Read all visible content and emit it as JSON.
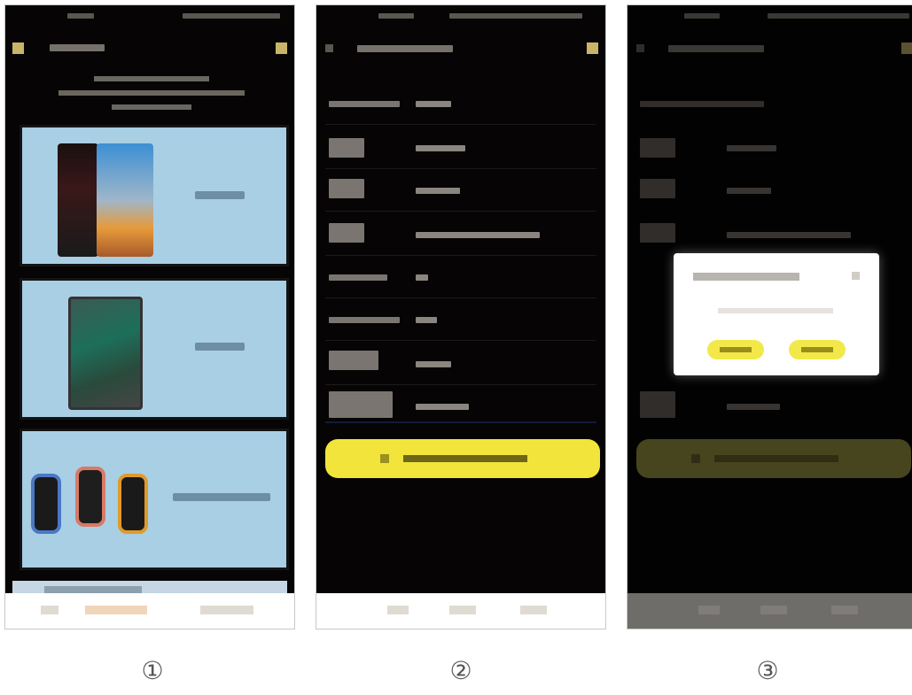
{
  "steps": [
    "①",
    "②",
    "③"
  ],
  "colors": {
    "screen_bg": "#060404",
    "card_blue": "#a8cfe4",
    "accent_yellow": "#f2e43a",
    "modal_bg": "#ffffff"
  },
  "icons": {
    "menu": "menu-icon",
    "action": "square-icon",
    "back": "back-arrow-icon",
    "close": "close-icon"
  }
}
